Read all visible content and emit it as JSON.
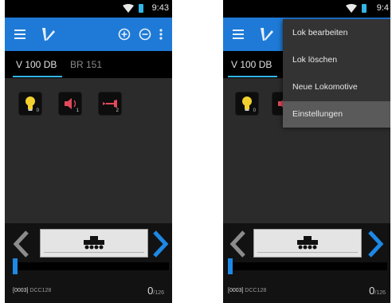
{
  "status_bar": {
    "time": "9:43",
    "time_right": "9:4"
  },
  "colors": {
    "action_bar": "#1e7ad6",
    "accent": "#33b5e5",
    "slider_thumb": "#1e88e5",
    "arrow_right": "#1e88e5"
  },
  "tabs": [
    {
      "label": "V 100 DB",
      "active": true
    },
    {
      "label": "BR 151",
      "active": false
    }
  ],
  "functions": [
    {
      "icon": "light-bulb-icon",
      "number": "0"
    },
    {
      "icon": "speaker-icon",
      "number": "1"
    },
    {
      "icon": "horn-icon",
      "number": "2"
    }
  ],
  "throttle": {
    "address_code": "[0003]",
    "protocol": "DCC128",
    "speed": "0",
    "speed_max": "/126"
  },
  "overflow_menu": {
    "items": [
      "Lok bearbeiten",
      "Lok löschen",
      "Neue Lokomotive",
      "Einstellungen"
    ],
    "selected": "Einstellungen"
  }
}
